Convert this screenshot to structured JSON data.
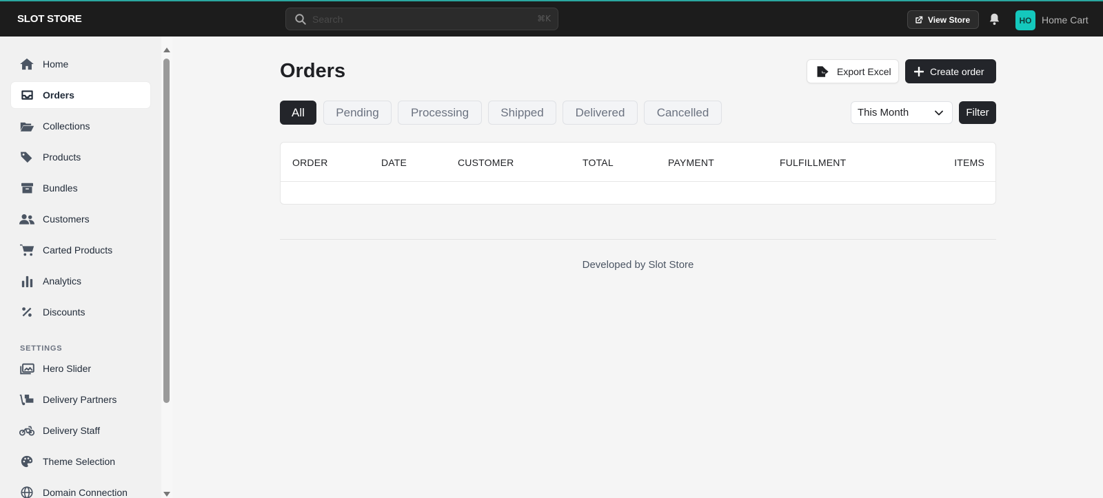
{
  "topbar": {
    "brand": "SLOT STORE",
    "search_placeholder": "Search",
    "search_shortcut": "⌘K",
    "view_store_label": "View Store",
    "avatar_initials": "HO",
    "store_name": "Home Cart"
  },
  "sidebar": {
    "items": [
      {
        "label": "Home",
        "icon": "home-icon"
      },
      {
        "label": "Orders",
        "icon": "inbox-icon",
        "active": true
      },
      {
        "label": "Collections",
        "icon": "folder-open-icon"
      },
      {
        "label": "Products",
        "icon": "tags-icon"
      },
      {
        "label": "Bundles",
        "icon": "archive-box-icon"
      },
      {
        "label": "Customers",
        "icon": "users-icon"
      },
      {
        "label": "Carted Products",
        "icon": "cart-icon"
      },
      {
        "label": "Analytics",
        "icon": "bar-chart-icon"
      },
      {
        "label": "Discounts",
        "icon": "percent-icon"
      }
    ],
    "settings_label": "SETTINGS",
    "settings_items": [
      {
        "label": "Hero Slider",
        "icon": "images-icon"
      },
      {
        "label": "Delivery Partners",
        "icon": "dolly-icon"
      },
      {
        "label": "Delivery Staff",
        "icon": "motorcycle-icon"
      },
      {
        "label": "Theme Selection",
        "icon": "palette-icon"
      },
      {
        "label": "Domain Connection",
        "icon": "globe-icon"
      }
    ]
  },
  "main": {
    "title": "Orders",
    "export_label": "Export Excel",
    "create_label": "Create order",
    "tabs": [
      "All",
      "Pending",
      "Processing",
      "Shipped",
      "Delivered",
      "Cancelled"
    ],
    "active_tab": "All",
    "period_selected": "This Month",
    "filter_label": "Filter",
    "table_headers": [
      "ORDER",
      "DATE",
      "CUSTOMER",
      "TOTAL",
      "PAYMENT",
      "FULFILLMENT",
      "ITEMS"
    ],
    "rows": []
  },
  "footer": {
    "text": "Developed by Slot Store"
  },
  "colors": {
    "topbar_bg": "#1c1c1c",
    "accent": "#14c8bd",
    "primary_button": "#23252a",
    "page_bg": "#f5f5f5"
  }
}
